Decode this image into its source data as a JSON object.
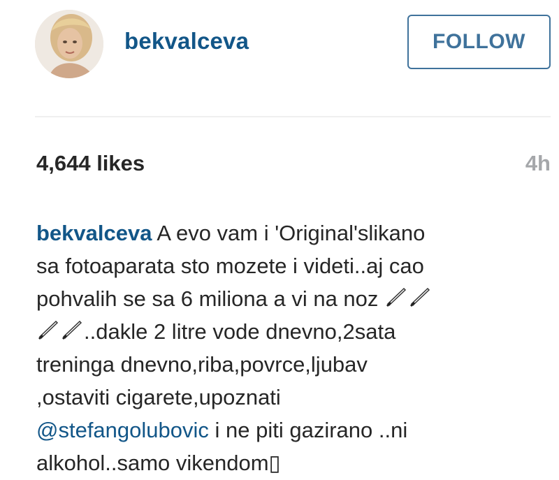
{
  "post": {
    "username": "bekvalceva",
    "follow_label": "FOLLOW",
    "likes": "4,644 likes",
    "time_ago": "4h"
  },
  "caption": {
    "username": "bekvalceva",
    "line1_text": " A evo vam i 'Original'slikano",
    "line2_text": "sa fotoaparata sto mozete i videti..aj cao",
    "line3_text": "pohvalih se sa 6 miliona a vi na noz ",
    "line4_text": "..dakle 2 litre vode dnevno,2sata",
    "line5_text": "treninga dnevno,riba,povrce,ljubav",
    "line6_text": ",ostaviti cigarete,upoznati",
    "mention": "@stefangolubovic",
    "line7_text": " i ne piti gazirano ..ni",
    "line8_text": "alkohol..samo vikendom▯"
  },
  "icons": {
    "avatar": "profile-photo",
    "emoji": "knife-icon"
  },
  "colors": {
    "link": "#125688",
    "follow": "#3f729b",
    "text": "#262626",
    "muted": "#a5a7aa"
  }
}
